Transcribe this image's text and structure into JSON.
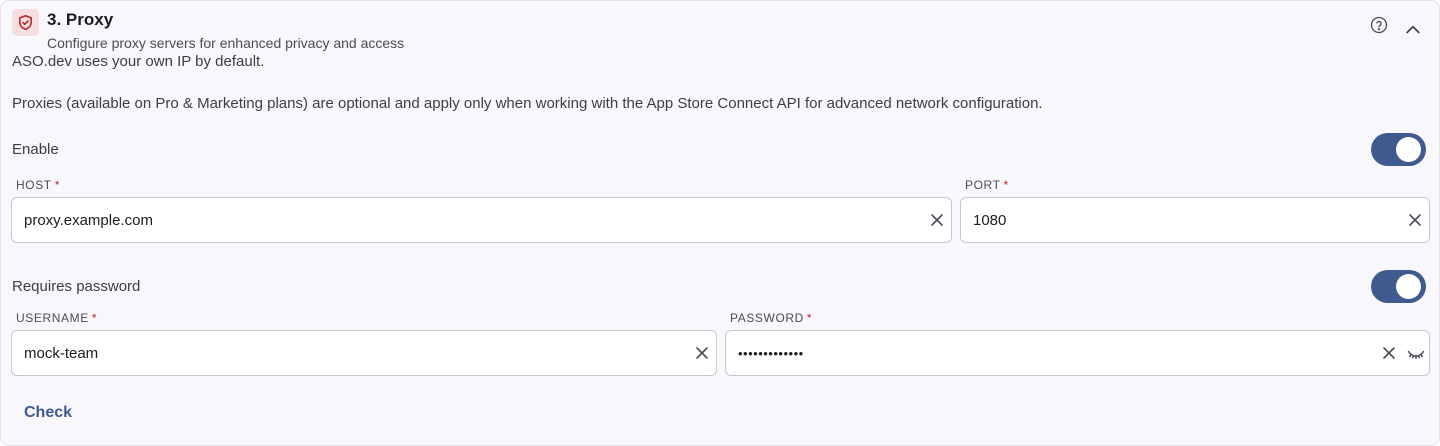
{
  "header": {
    "title": "3. Proxy",
    "subtitle": "Configure proxy servers for enhanced privacy and access",
    "icon": "shield-icon",
    "icon_color": "#b3262e"
  },
  "description": {
    "line1": "ASO.dev uses your own IP by default.",
    "line2": "Proxies (available on Pro & Marketing plans) are optional and apply only when working with the App Store Connect API for advanced network configuration."
  },
  "enable": {
    "label": "Enable",
    "on": true
  },
  "host": {
    "label": "HOST",
    "required_mark": "*",
    "value": "proxy.example.com"
  },
  "port": {
    "label": "PORT",
    "required_mark": "*",
    "value": "1080"
  },
  "requires_password": {
    "label": "Requires password",
    "on": true
  },
  "username": {
    "label": "USERNAME",
    "required_mark": "*",
    "value": "mock-team"
  },
  "password": {
    "label": "PASSWORD",
    "required_mark": "*",
    "value": "•••••••••••••"
  },
  "actions": {
    "check_label": "Check"
  },
  "colors": {
    "accent": "#3f5a8f",
    "required": "#c0262d",
    "panel_bg": "#f8f7fc"
  }
}
